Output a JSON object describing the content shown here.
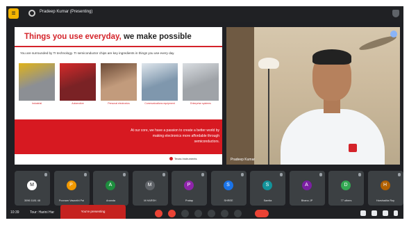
{
  "titlebar": {
    "presenting_label": "Pradeep Kumar (Presenting)"
  },
  "slide": {
    "title_highlight": "Things you use everyday,",
    "title_rest": "we make possible",
    "subtitle": "You are surrounded by TI technology. TI semiconductor chips are key ingredients in things you use every day.",
    "images": [
      {
        "caption": "Industrial",
        "color": "#8c8f94",
        "accent": "#e0b31a"
      },
      {
        "caption": "Automotive",
        "color": "#7a2225",
        "accent": "#d42a2a"
      },
      {
        "caption": "Personal electronics",
        "color": "#c29b7c",
        "accent": "#6b4a36"
      },
      {
        "caption": "Communications equipment",
        "color": "#7f97ad",
        "accent": "#dfe6ec"
      },
      {
        "caption": "Enterprise systems",
        "color": "#9fa3a8",
        "accent": "#d9dde1"
      }
    ],
    "band_text": "At our core, we have a passion to create a better world by making electronics more affordable through semiconductors.",
    "footer": "Texas Instruments"
  },
  "speaker": {
    "name": "Pradeep Kumar"
  },
  "participants": [
    {
      "name": "3096 1181 48",
      "initial": "M",
      "color": "#ffffff",
      "text_color": "#202124"
    },
    {
      "name": "Poonam Vasanthi Pai",
      "initial": "P",
      "color": "#f29900",
      "text_color": "#ffffff"
    },
    {
      "name": "Ananda",
      "initial": "A",
      "color": "#1e8e3e",
      "text_color": "#ffffff"
    },
    {
      "name": "M HARSH",
      "initial": "M",
      "color": "#5f6368",
      "text_color": "#ffffff"
    },
    {
      "name": "Pratap",
      "initial": "P",
      "color": "#8e24aa",
      "text_color": "#ffffff"
    },
    {
      "name": "SHREE",
      "initial": "S",
      "color": "#1a73e8",
      "text_color": "#ffffff"
    },
    {
      "name": "Samita",
      "initial": "S",
      "color": "#12939a",
      "text_color": "#ffffff"
    },
    {
      "name": "Bhanu JP",
      "initial": "A",
      "color": "#7b1fa2",
      "text_color": "#ffffff"
    },
    {
      "name": "77 others",
      "initial": "D",
      "color": "#34a853",
      "text_color": "#ffffff"
    },
    {
      "name": "Harshadita Roy",
      "initial": "H",
      "color": "#b06000",
      "text_color": "#ffffff"
    }
  ],
  "bottombar": {
    "time": "10:39",
    "meeting": "Tour: Harini Har",
    "present_banner": "You're presenting"
  },
  "colors": {
    "accent_red": "#d4232a",
    "meet_bg": "#202124"
  }
}
